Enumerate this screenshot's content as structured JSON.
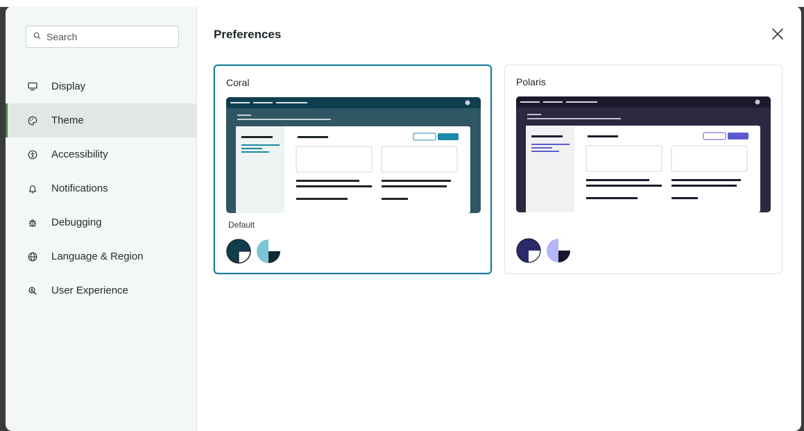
{
  "search": {
    "placeholder": "Search"
  },
  "sidebar": {
    "items": [
      {
        "label": "Display",
        "icon": "monitor-icon"
      },
      {
        "label": "Theme",
        "icon": "palette-icon"
      },
      {
        "label": "Accessibility",
        "icon": "accessibility-icon"
      },
      {
        "label": "Notifications",
        "icon": "bell-icon"
      },
      {
        "label": "Debugging",
        "icon": "bug-icon"
      },
      {
        "label": "Language & Region",
        "icon": "globe-icon"
      },
      {
        "label": "User Experience",
        "icon": "user-experience-icon"
      }
    ],
    "active": "Theme"
  },
  "main": {
    "title": "Preferences",
    "themes": [
      {
        "name": "Coral",
        "selected": true,
        "mode_label": "Default",
        "colors": {
          "topbar": "#0f3e4e",
          "header": "#2f5663",
          "accent": "#1b88a8",
          "border": "#1b7d99",
          "swatch_dark": "#0f3e4e",
          "swatch_light": "#7cc4d4"
        }
      },
      {
        "name": "Polaris",
        "selected": false,
        "mode_label": "",
        "colors": {
          "topbar": "#1b1a2c",
          "header": "#2b2940",
          "accent": "#5a5ad2",
          "border": "#dde3e3",
          "swatch_dark": "#2b2a6a",
          "swatch_light": "#b5b5fa"
        }
      }
    ]
  }
}
